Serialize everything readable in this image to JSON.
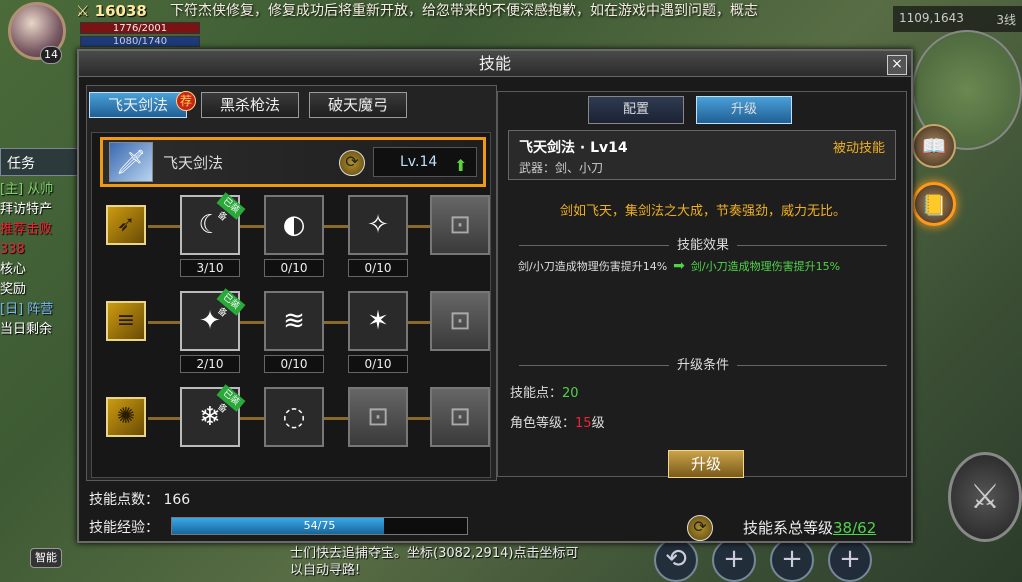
{
  "hud": {
    "power": "16038",
    "hp": "1776/2001",
    "mp": "1080/1740",
    "level": "14",
    "top_message": "下符杰侠修复，修复成功后将重新开放，给忽带来的不便深感抱歉，如在游戏中遇到问题，概志",
    "map_coord": "1109,1643",
    "line": "3线",
    "quest_tab": "任务",
    "quest_lines": [
      "[主] 从帅",
      "拜访特产",
      "推荐击败",
      "338",
      "核心",
      "奖励",
      "[日] 阵营",
      "当日剩余"
    ],
    "chat": [
      "士们快去追捕夺宝。坐标(3082,2914)点击坐标可",
      "以自动寻路!"
    ],
    "auto_btn": "智能",
    "attack_icon": "sword-icon"
  },
  "window": {
    "title": "技能",
    "close": "×"
  },
  "left": {
    "tabs": [
      {
        "label": "飞天剑法",
        "active": true
      },
      {
        "label": "黑杀枪法",
        "active": false
      },
      {
        "label": "破天魔弓",
        "active": false
      }
    ],
    "rec_badge": "荐",
    "selected": {
      "name": "飞天剑法",
      "level": "Lv.14"
    },
    "rows": [
      {
        "nodes": [
          {
            "lv": "3/10",
            "equipped": true,
            "badge": "已装备",
            "icon": "☾"
          },
          {
            "lv": "0/10",
            "icon": "◐"
          },
          {
            "lv": "0/10",
            "icon": "✧"
          },
          {
            "lock": true,
            "icon": "⊡"
          }
        ]
      },
      {
        "nodes": [
          {
            "lv": "2/10",
            "equipped": true,
            "badge": "已装备",
            "icon": "✦"
          },
          {
            "lv": "0/10",
            "icon": "≋"
          },
          {
            "lv": "0/10",
            "icon": "✶"
          },
          {
            "lock": true,
            "icon": "⊡"
          }
        ]
      },
      {
        "nodes": [
          {
            "lv": "",
            "equipped": true,
            "badge": "已装备",
            "icon": "❄"
          },
          {
            "lv": "",
            "icon": "◌"
          },
          {
            "lock": true,
            "icon": "⊡"
          },
          {
            "lock": true,
            "icon": "⊡"
          }
        ]
      }
    ],
    "skill_points_label": "技能点数：",
    "skill_points": "166",
    "skill_exp_label": "技能经验：",
    "skill_exp": "54/75",
    "skill_exp_fraction": 0.72
  },
  "right": {
    "tabs": [
      {
        "label": "配置",
        "active": false
      },
      {
        "label": "升级",
        "active": true
      }
    ],
    "name": "飞天剑法 · Lv14",
    "weapon": "武器：剑、小刀",
    "type": "被动技能",
    "desc": "剑如飞天，集剑法之大成，节奏强劲，威力无比。",
    "effect_title": "技能效果",
    "effect_old": "剑/小刀造成物理伤害提升14%",
    "effect_new": "剑/小刀造成物理伤害提升15%",
    "cond_title": "升级条件",
    "cond_points_label": "技能点：",
    "cond_points": "20",
    "cond_level_label": "角色等级：",
    "cond_level": "15",
    "cond_level_unit": "级",
    "upgrade_btn": "升级"
  },
  "system": {
    "label": "技能系总等级",
    "value": "38/62"
  }
}
